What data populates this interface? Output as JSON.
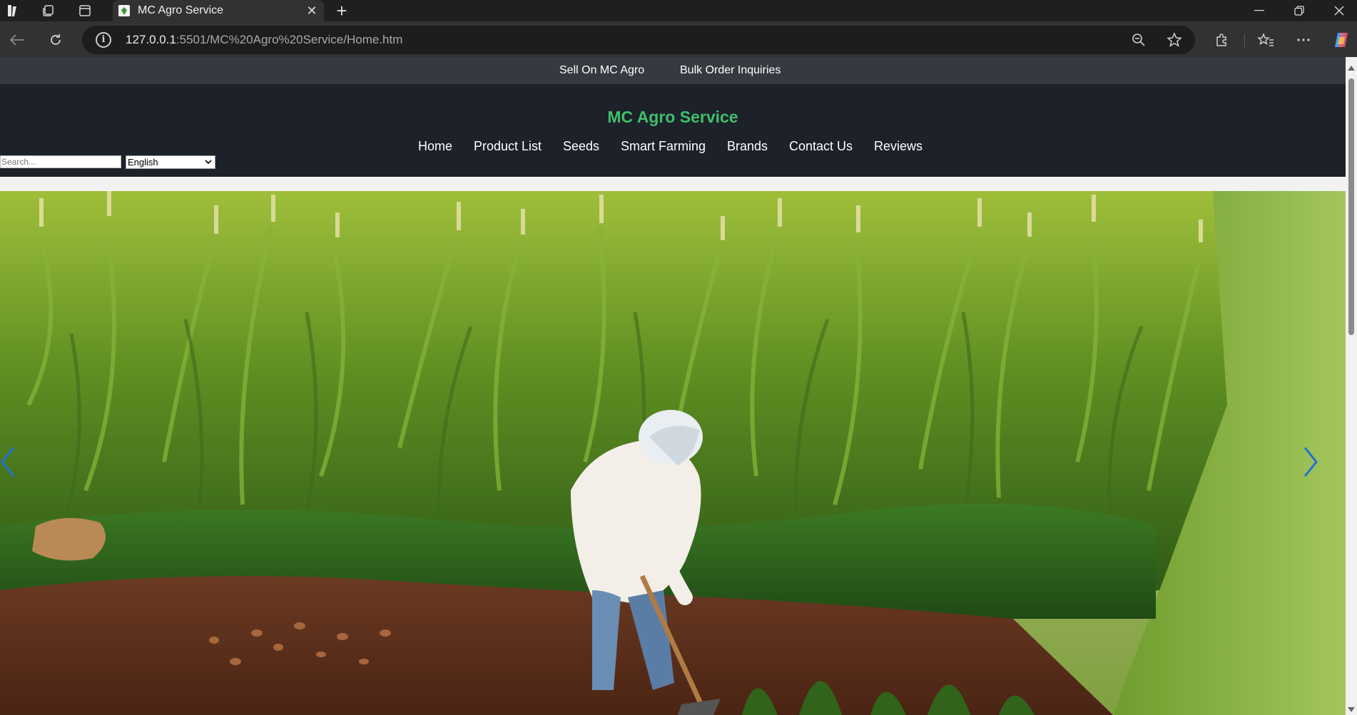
{
  "browser": {
    "tab_title": "MC Agro Service",
    "url_host": "127.0.0.1",
    "url_rest": ":5501/MC%20Agro%20Service/Home.htm"
  },
  "topbar": {
    "sell_link": "Sell On MC Agro",
    "bulk_link": "Bulk Order Inquiries"
  },
  "header": {
    "brand": "MC Agro Service",
    "menu": [
      "Home",
      "Product List",
      "Seeds",
      "Smart Farming",
      "Brands",
      "Contact Us",
      "Reviews"
    ],
    "search_placeholder": "Search...",
    "language_selected": "English"
  },
  "hero": {
    "image_alt": "Farmer digging soil beside maize field",
    "prev_icon": "chevron-left-icon",
    "next_icon": "chevron-right-icon",
    "arrow_color": "#1e73d6"
  },
  "colors": {
    "brand_green": "#3fbf6a",
    "header_bg": "#1c212a",
    "topbar_bg": "#353a40"
  }
}
